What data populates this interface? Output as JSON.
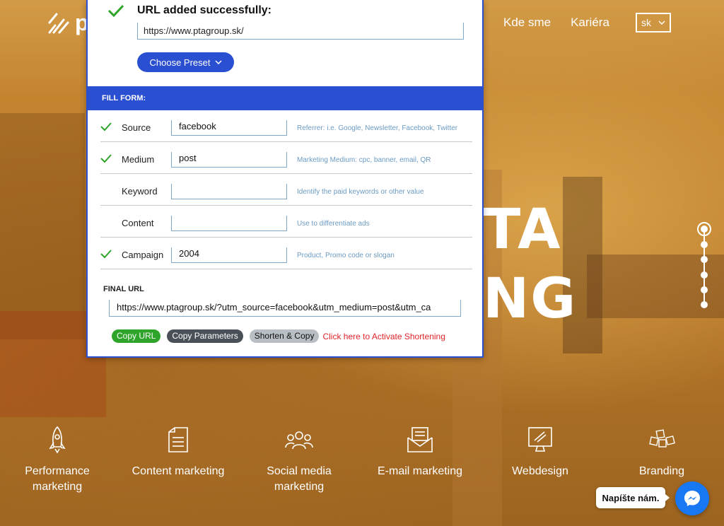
{
  "header": {
    "logo_text": "p",
    "nav": [
      "Kde sme",
      "Kariéra"
    ],
    "lang": "sk"
  },
  "hero": {
    "line1": "TA",
    "line2": "NG"
  },
  "pager": {
    "count": 6,
    "active_index": 0
  },
  "services": [
    {
      "label": "Performance marketing",
      "icon": "rocket-icon"
    },
    {
      "label": "Content marketing",
      "icon": "document-icon"
    },
    {
      "label": "Social media marketing",
      "icon": "people-icon"
    },
    {
      "label": "E-mail marketing",
      "icon": "envelope-icon"
    },
    {
      "label": "Webdesign",
      "icon": "monitor-icon"
    },
    {
      "label": "Branding",
      "icon": "blocks-icon"
    }
  ],
  "chat": {
    "tooltip": "Napíšte nám."
  },
  "panel": {
    "success_title": "URL added successfully:",
    "url": "https://www.ptagroup.sk/",
    "preset_label": "Choose Preset",
    "fill_form_label": "FILL FORM:",
    "rows": [
      {
        "label": "Source",
        "value": "facebook",
        "hint": "Referrer: i.e. Google, Newsletter, Facebook, Twitter",
        "checked": true
      },
      {
        "label": "Medium",
        "value": "post",
        "hint": "Marketing Medium: cpc, banner, email, QR",
        "checked": true
      },
      {
        "label": "Keyword",
        "value": "",
        "hint": "Identify the paid keywords or other value",
        "checked": false
      },
      {
        "label": "Content",
        "value": "",
        "hint": "Use to differentiate ads",
        "checked": false
      },
      {
        "label": "Campaign",
        "value": "2004",
        "hint": "Product, Promo code or slogan",
        "checked": true
      }
    ],
    "final_url_label": "FINAL URL",
    "final_url": "https://www.ptagroup.sk/?utm_source=facebook&utm_medium=post&utm_ca",
    "buttons": {
      "copy_url": "Copy URL",
      "copy_params": "Copy Parameters",
      "shorten_copy": "Shorten & Copy",
      "activate_link": "Click here to Activate Shortening"
    }
  },
  "colors": {
    "accent_blue": "#2a4fd1",
    "check_green": "#2ea52a",
    "hint_blue": "#6b9bc3",
    "link_red": "#e0242a",
    "messenger_blue": "#1877f2"
  }
}
